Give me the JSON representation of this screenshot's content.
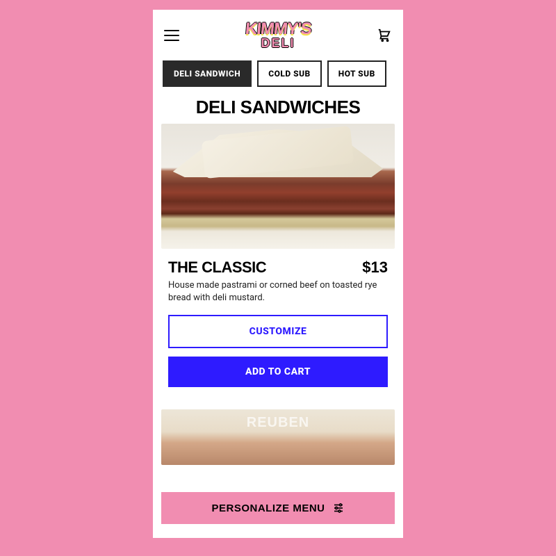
{
  "brand": {
    "name_top": "KIMMY'S",
    "name_bottom": "DELI"
  },
  "tabs": [
    {
      "label": "DELI SANDWICH",
      "active": true
    },
    {
      "label": "COLD SUB",
      "active": false
    },
    {
      "label": "HOT SUB",
      "active": false
    }
  ],
  "section": {
    "title": "DELI SANDWICHES"
  },
  "product": {
    "name": "THE CLASSIC",
    "price": "$13",
    "description": "House made pastrami or corned beef on toasted rye bread with deli mustard.",
    "customize_label": "CUSTOMIZE",
    "add_label": "ADD TO CART"
  },
  "next_product_peek": "REUBEN",
  "personalize": {
    "label": "PERSONALIZE MENU"
  }
}
